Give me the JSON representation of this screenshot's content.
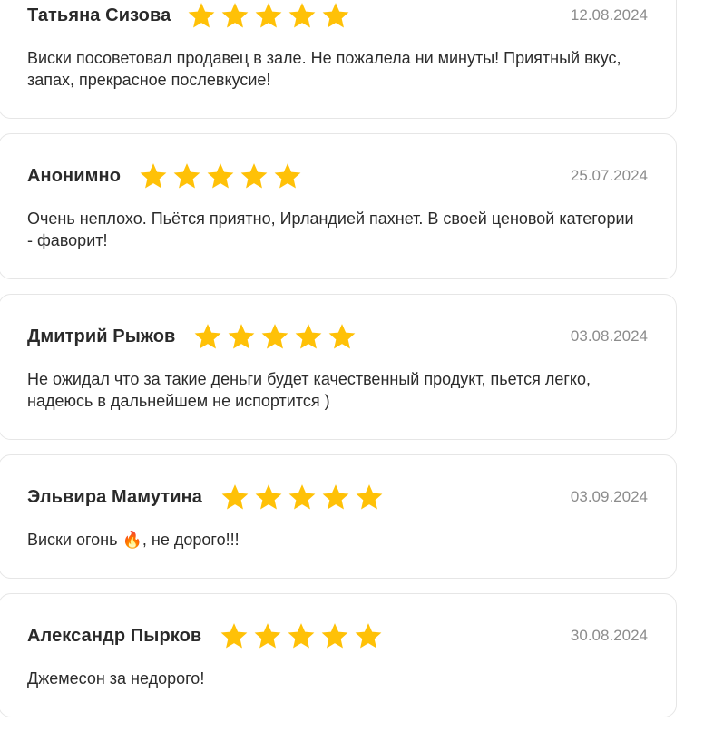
{
  "reviews": [
    {
      "author": "Татьяна Сизова",
      "rating": 5,
      "date": "12.08.2024",
      "text": "Виски посоветовал продавец в зале. Не пожалела ни минуты! Приятный вкус, запах, прекрасное послевкусие!"
    },
    {
      "author": "Анонимно",
      "rating": 5,
      "date": "25.07.2024",
      "text": "Очень неплохо. Пьётся приятно, Ирландией пахнет. В своей ценовой категории - фаворит!"
    },
    {
      "author": "Дмитрий Рыжов",
      "rating": 5,
      "date": "03.08.2024",
      "text": "Не ожидал что за такие деньги будет качественный продукт, пьется легко, надеюсь в дальнейшем не испортится )"
    },
    {
      "author": "Эльвира Мамутина",
      "rating": 5,
      "date": "03.09.2024",
      "text": "Виски огонь 🔥, не дорого!!!"
    },
    {
      "author": "Александр Пырков",
      "rating": 5,
      "date": "30.08.2024",
      "text": "Джемесон за недорого!"
    }
  ],
  "colors": {
    "star": "#FFC107",
    "border": "#E6E6E6",
    "date": "#8C8C8C",
    "text": "#2B2B2B"
  },
  "icons": {
    "star": "star-icon"
  }
}
